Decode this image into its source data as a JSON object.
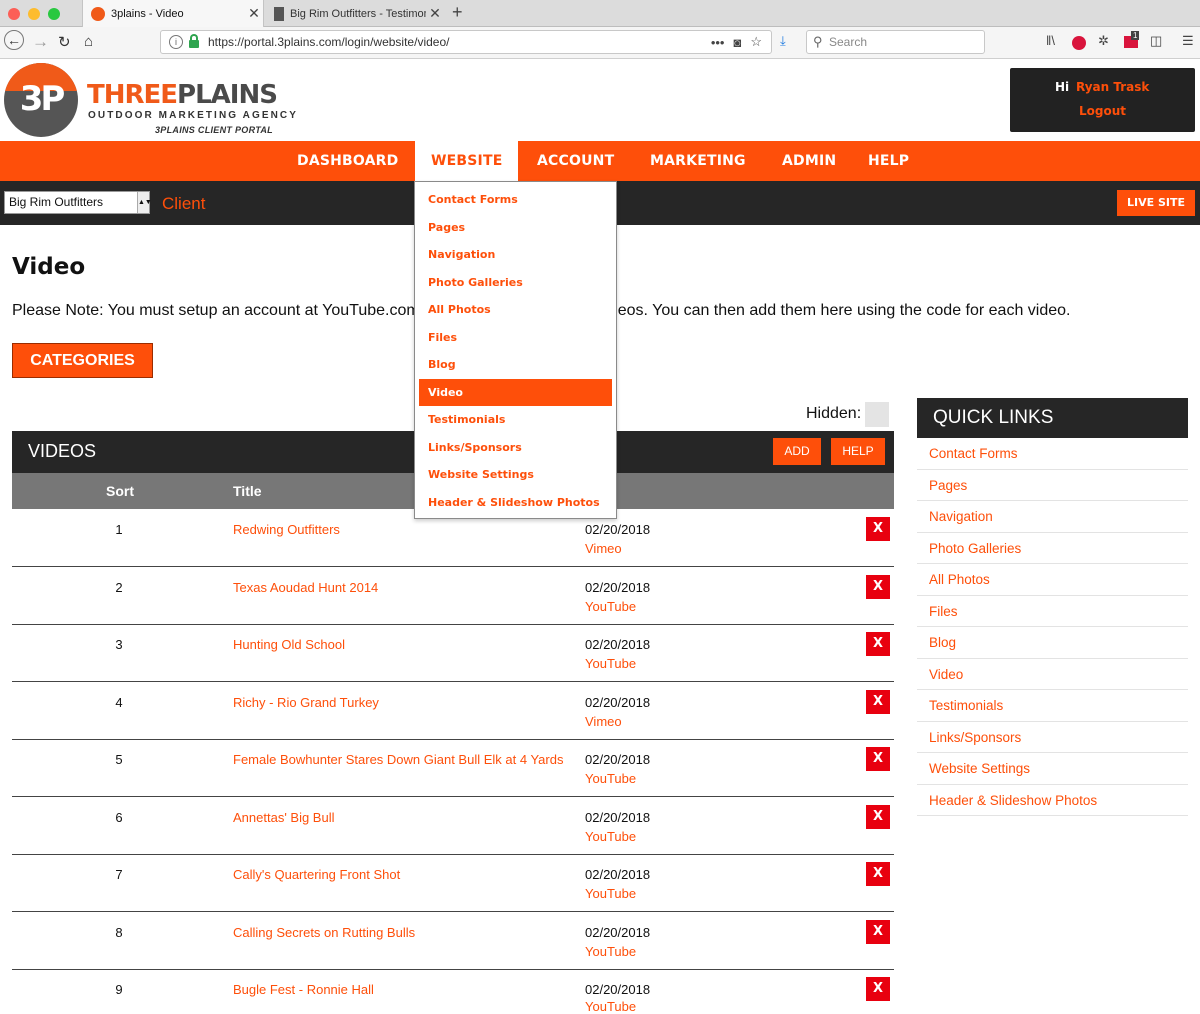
{
  "browser": {
    "active_tab": "3plains - Video",
    "inactive_tab": "Big Rim Outfitters - Testimonials",
    "url": "https://portal.3plains.com/login/website/video/",
    "search_placeholder": "Search",
    "badge": "1"
  },
  "header": {
    "logo_mono": "3P",
    "brand_part1": "THREE",
    "brand_part2": "PLAINS",
    "tagline": "OUTDOOR MARKETING AGENCY",
    "portal_label": "3PLAINS CLIENT PORTAL",
    "greeting": "Hi",
    "user_name": "Ryan Trask",
    "logout": "Logout"
  },
  "nav": {
    "dashboard": "DASHBOARD",
    "website": "WEBSITE",
    "account": "ACCOUNT",
    "marketing": "MARKETING",
    "admin": "ADMIN",
    "help": "HELP"
  },
  "subbar": {
    "client_value": "Big Rim Outfitters",
    "client_label": "Client",
    "live_site": "LIVE SITE"
  },
  "dropdown": [
    "Contact Forms",
    "Pages",
    "Navigation",
    "Photo Galleries",
    "All Photos",
    "Files",
    "Blog",
    "Video",
    "Testimonials",
    "Links/Sponsors",
    "Website Settings",
    "Header & Slideshow Photos"
  ],
  "content": {
    "title": "Video",
    "note": "Please Note: You must setup an account at YouTube.com or Vimeo.com to upload videos. You can then add them here using the code for each video.",
    "categories_button": "CATEGORIES",
    "hidden_label": "Hidden:",
    "videos_title": "VIDEOS",
    "add_button": "ADD",
    "help_button": "HELP",
    "col_sort": "Sort",
    "col_title": "Title",
    "delete_label": "X"
  },
  "videos": [
    {
      "sort": "1",
      "title": "Redwing Outfitters",
      "date": "02/20/2018",
      "source": "Vimeo"
    },
    {
      "sort": "2",
      "title": "Texas Aoudad Hunt 2014",
      "date": "02/20/2018",
      "source": "YouTube"
    },
    {
      "sort": "3",
      "title": "Hunting Old School",
      "date": "02/20/2018",
      "source": "YouTube"
    },
    {
      "sort": "4",
      "title": "Richy - Rio Grand Turkey",
      "date": "02/20/2018",
      "source": "Vimeo"
    },
    {
      "sort": "5",
      "title": "Female Bowhunter Stares Down Giant Bull Elk at 4 Yards",
      "date": "02/20/2018",
      "source": "YouTube"
    },
    {
      "sort": "6",
      "title": "Annettas' Big Bull",
      "date": "02/20/2018",
      "source": "YouTube"
    },
    {
      "sort": "7",
      "title": "Cally's Quartering Front Shot",
      "date": "02/20/2018",
      "source": "YouTube"
    },
    {
      "sort": "8",
      "title": "Calling Secrets on Rutting Bulls",
      "date": "02/20/2018",
      "source": "YouTube"
    },
    {
      "sort": "9",
      "title": "Bugle Fest - Ronnie Hall",
      "date": "02/20/2018",
      "source": "YouTube"
    }
  ],
  "quick_links": {
    "title": "QUICK LINKS",
    "items": [
      "Contact Forms",
      "Pages",
      "Navigation",
      "Photo Galleries",
      "All Photos",
      "Files",
      "Blog",
      "Video",
      "Testimonials",
      "Links/Sponsors",
      "Website Settings",
      "Header & Slideshow Photos"
    ]
  },
  "colors": {
    "accent": "#fe4f0a",
    "dark": "#262626",
    "delete_red": "#e8000f"
  }
}
